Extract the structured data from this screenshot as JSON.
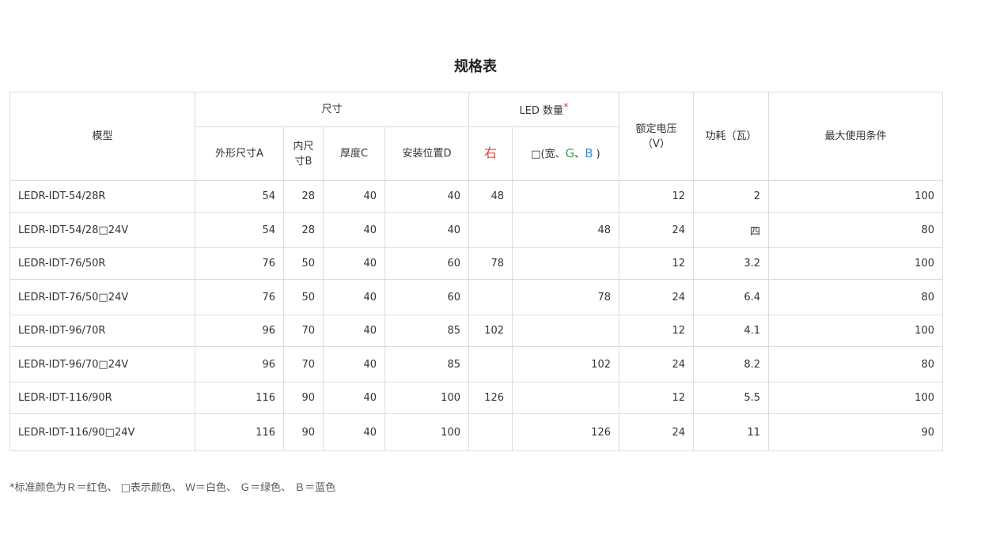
{
  "title": "规格表",
  "header": {
    "model": "模型",
    "size_group": "尺寸",
    "outer_size": "外形尺寸A",
    "inner_size_line1": "内尺",
    "inner_size_line2": "寸B",
    "thickness": "厚度C",
    "mount_pos": "安装位置D",
    "led_group": "LED 数量",
    "led_asterisk": "*",
    "led_red": "右",
    "led_other_prefix": "□(宽、",
    "led_g": "G",
    "led_sep": "、",
    "led_b": "B",
    "led_close": ")",
    "voltage_line1": "额定电压",
    "voltage_line2": "（V）",
    "power": "功耗（瓦）",
    "max_cond": "最大使用条件"
  },
  "rows": [
    {
      "model": "LEDR-IDT-54/28R",
      "a": "54",
      "b": "28",
      "c": "40",
      "d": "40",
      "led_r": "48",
      "led_other": "",
      "voltage": "12",
      "power": "2",
      "max": "100"
    },
    {
      "model": "LEDR-IDT-54/28□24V",
      "a": "54",
      "b": "28",
      "c": "40",
      "d": "40",
      "led_r": "",
      "led_other": "48",
      "voltage": "24",
      "power": "四",
      "max": "80"
    },
    {
      "model": "LEDR-IDT-76/50R",
      "a": "76",
      "b": "50",
      "c": "40",
      "d": "60",
      "led_r": "78",
      "led_other": "",
      "voltage": "12",
      "power": "3.2",
      "max": "100"
    },
    {
      "model": "LEDR-IDT-76/50□24V",
      "a": "76",
      "b": "50",
      "c": "40",
      "d": "60",
      "led_r": "",
      "led_other": "78",
      "voltage": "24",
      "power": "6.4",
      "max": "80"
    },
    {
      "model": "LEDR-IDT-96/70R",
      "a": "96",
      "b": "70",
      "c": "40",
      "d": "85",
      "led_r": "102",
      "led_other": "",
      "voltage": "12",
      "power": "4.1",
      "max": "100"
    },
    {
      "model": "LEDR-IDT-96/70□24V",
      "a": "96",
      "b": "70",
      "c": "40",
      "d": "85",
      "led_r": "",
      "led_other": "102",
      "voltage": "24",
      "power": "8.2",
      "max": "80"
    },
    {
      "model": "LEDR-IDT-116/90R",
      "a": "116",
      "b": "90",
      "c": "40",
      "d": "100",
      "led_r": "126",
      "led_other": "",
      "voltage": "12",
      "power": "5.5",
      "max": "100"
    },
    {
      "model": "LEDR-IDT-116/90□24V",
      "a": "116",
      "b": "90",
      "c": "40",
      "d": "100",
      "led_r": "",
      "led_other": "126",
      "voltage": "24",
      "power": "11",
      "max": "90"
    }
  ],
  "footnote": "*标准颜色为Ｒ＝红色、 □表示颜色、 Ｗ＝白色、 Ｇ＝绿色、 Ｂ＝蓝色",
  "colors": {
    "accent_red": "#e23c3c",
    "green": "#2ea84c",
    "blue": "#3a8ad4",
    "border": "#dcdcdc"
  }
}
